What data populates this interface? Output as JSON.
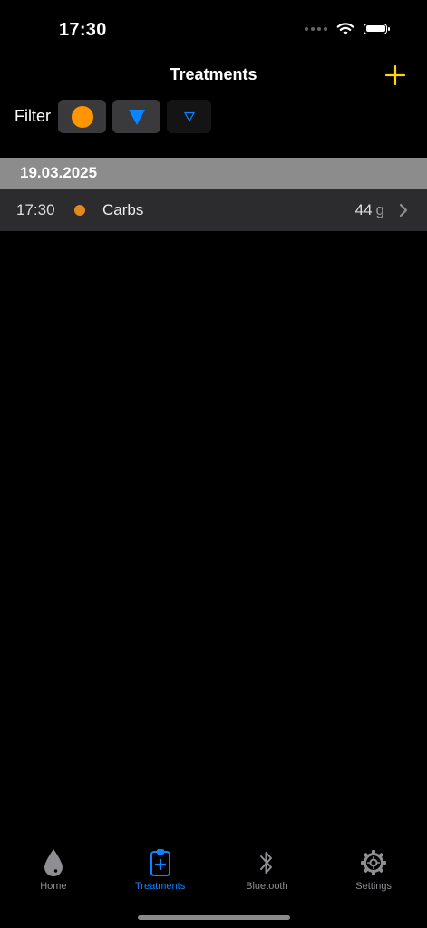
{
  "status_bar": {
    "time": "17:30"
  },
  "nav": {
    "title": "Treatments",
    "add_icon": "plus-icon"
  },
  "filter": {
    "label": "Filter",
    "buttons": [
      {
        "icon": "orange-circle-icon",
        "active": true
      },
      {
        "icon": "blue-triangle-filled-icon",
        "active": true
      },
      {
        "icon": "blue-triangle-outline-icon",
        "active": false
      }
    ]
  },
  "sections": [
    {
      "date": "19.03.2025",
      "rows": [
        {
          "time": "17:30",
          "type": "Carbs",
          "value": "44",
          "unit": "g"
        }
      ]
    }
  ],
  "tabs": [
    {
      "label": "Home",
      "icon": "drop-icon",
      "selected": false
    },
    {
      "label": "Treatments",
      "icon": "clipboard-plus-icon",
      "selected": true
    },
    {
      "label": "Bluetooth",
      "icon": "bluetooth-icon",
      "selected": false
    },
    {
      "label": "Settings",
      "icon": "gear-icon",
      "selected": false
    }
  ],
  "colors": {
    "accent": "#ffd60a",
    "tab_selected": "#0a84ff",
    "carbs": "#ff9500",
    "insulin": "#0a84ff"
  }
}
